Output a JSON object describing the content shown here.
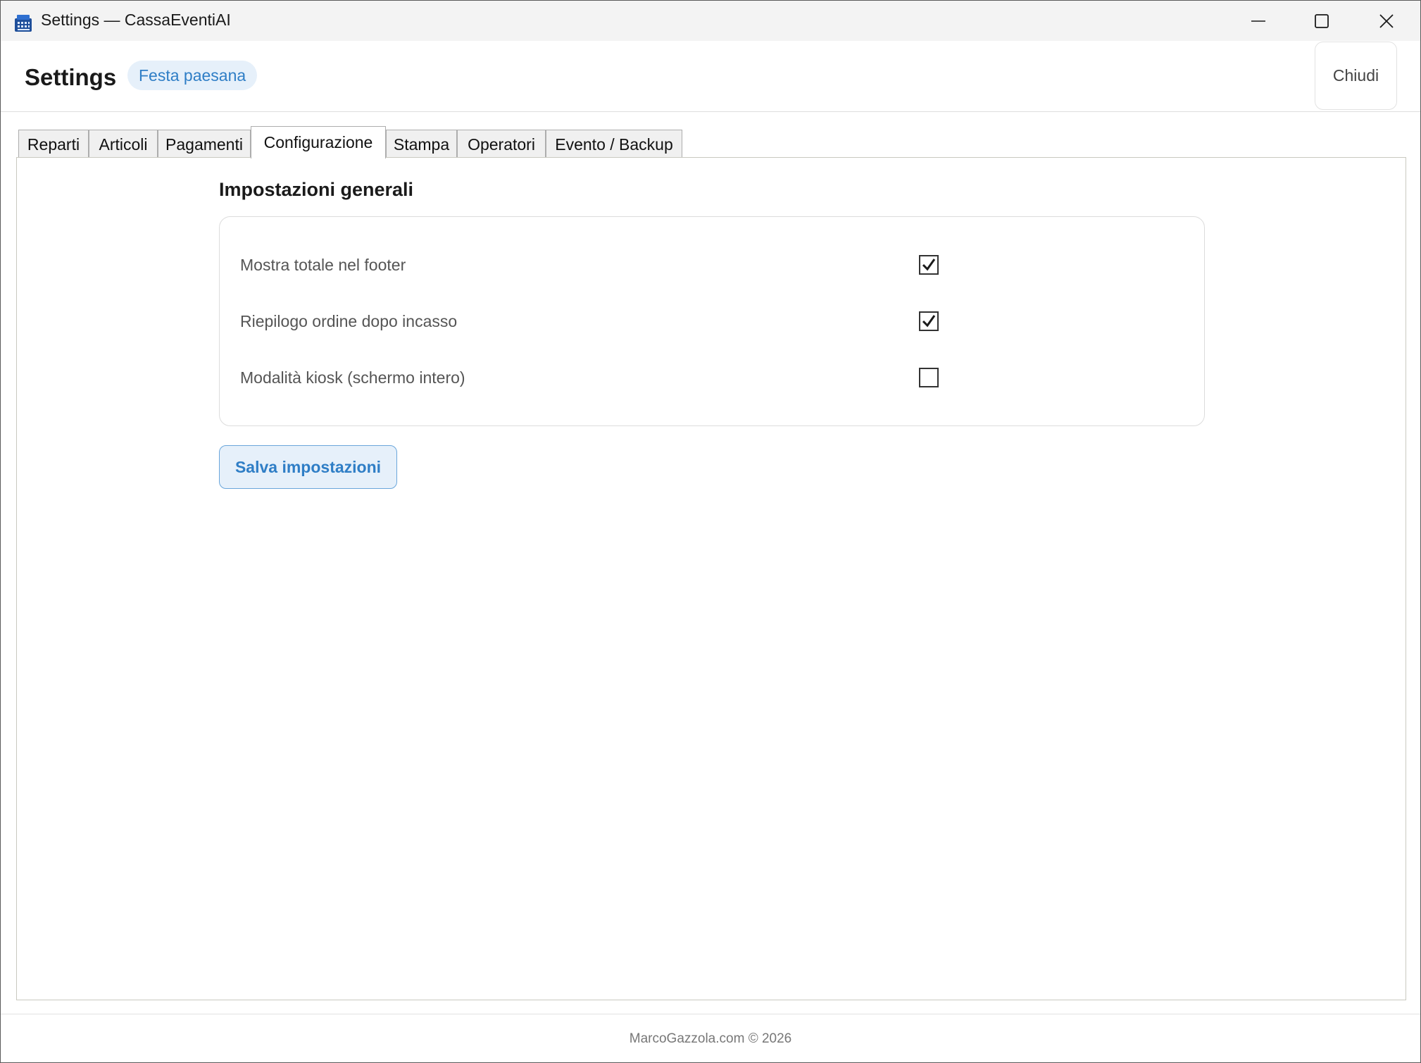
{
  "window": {
    "title": "Settings — CassaEventiAI",
    "app_icon": "cash-register-icon",
    "controls": [
      "minimize-icon",
      "maximize-icon",
      "close-icon"
    ]
  },
  "header": {
    "title": "Settings",
    "event_badge": "Festa paesana",
    "close_label": "Chiudi"
  },
  "tabs": [
    {
      "label": "Reparti",
      "active": false
    },
    {
      "label": "Articoli",
      "active": false
    },
    {
      "label": "Pagamenti",
      "active": false
    },
    {
      "label": "Configurazione",
      "active": true
    },
    {
      "label": "Stampa",
      "active": false
    },
    {
      "label": "Operatori",
      "active": false
    },
    {
      "label": "Evento / Backup",
      "active": false
    }
  ],
  "panel": {
    "section_title": "Impostazioni generali",
    "options": [
      {
        "label": "Mostra totale nel footer",
        "checked": true
      },
      {
        "label": "Riepilogo ordine dopo incasso",
        "checked": true
      },
      {
        "label": "Modalità kiosk (schermo intero)",
        "checked": false
      }
    ],
    "save_label": "Salva impostazioni"
  },
  "footer": {
    "text": "MarcoGazzola.com © 2026"
  },
  "colors": {
    "accent": "#2f7ec6",
    "accent_bg": "#e6f0fa",
    "titlebar_bg": "#f3f3f3"
  }
}
